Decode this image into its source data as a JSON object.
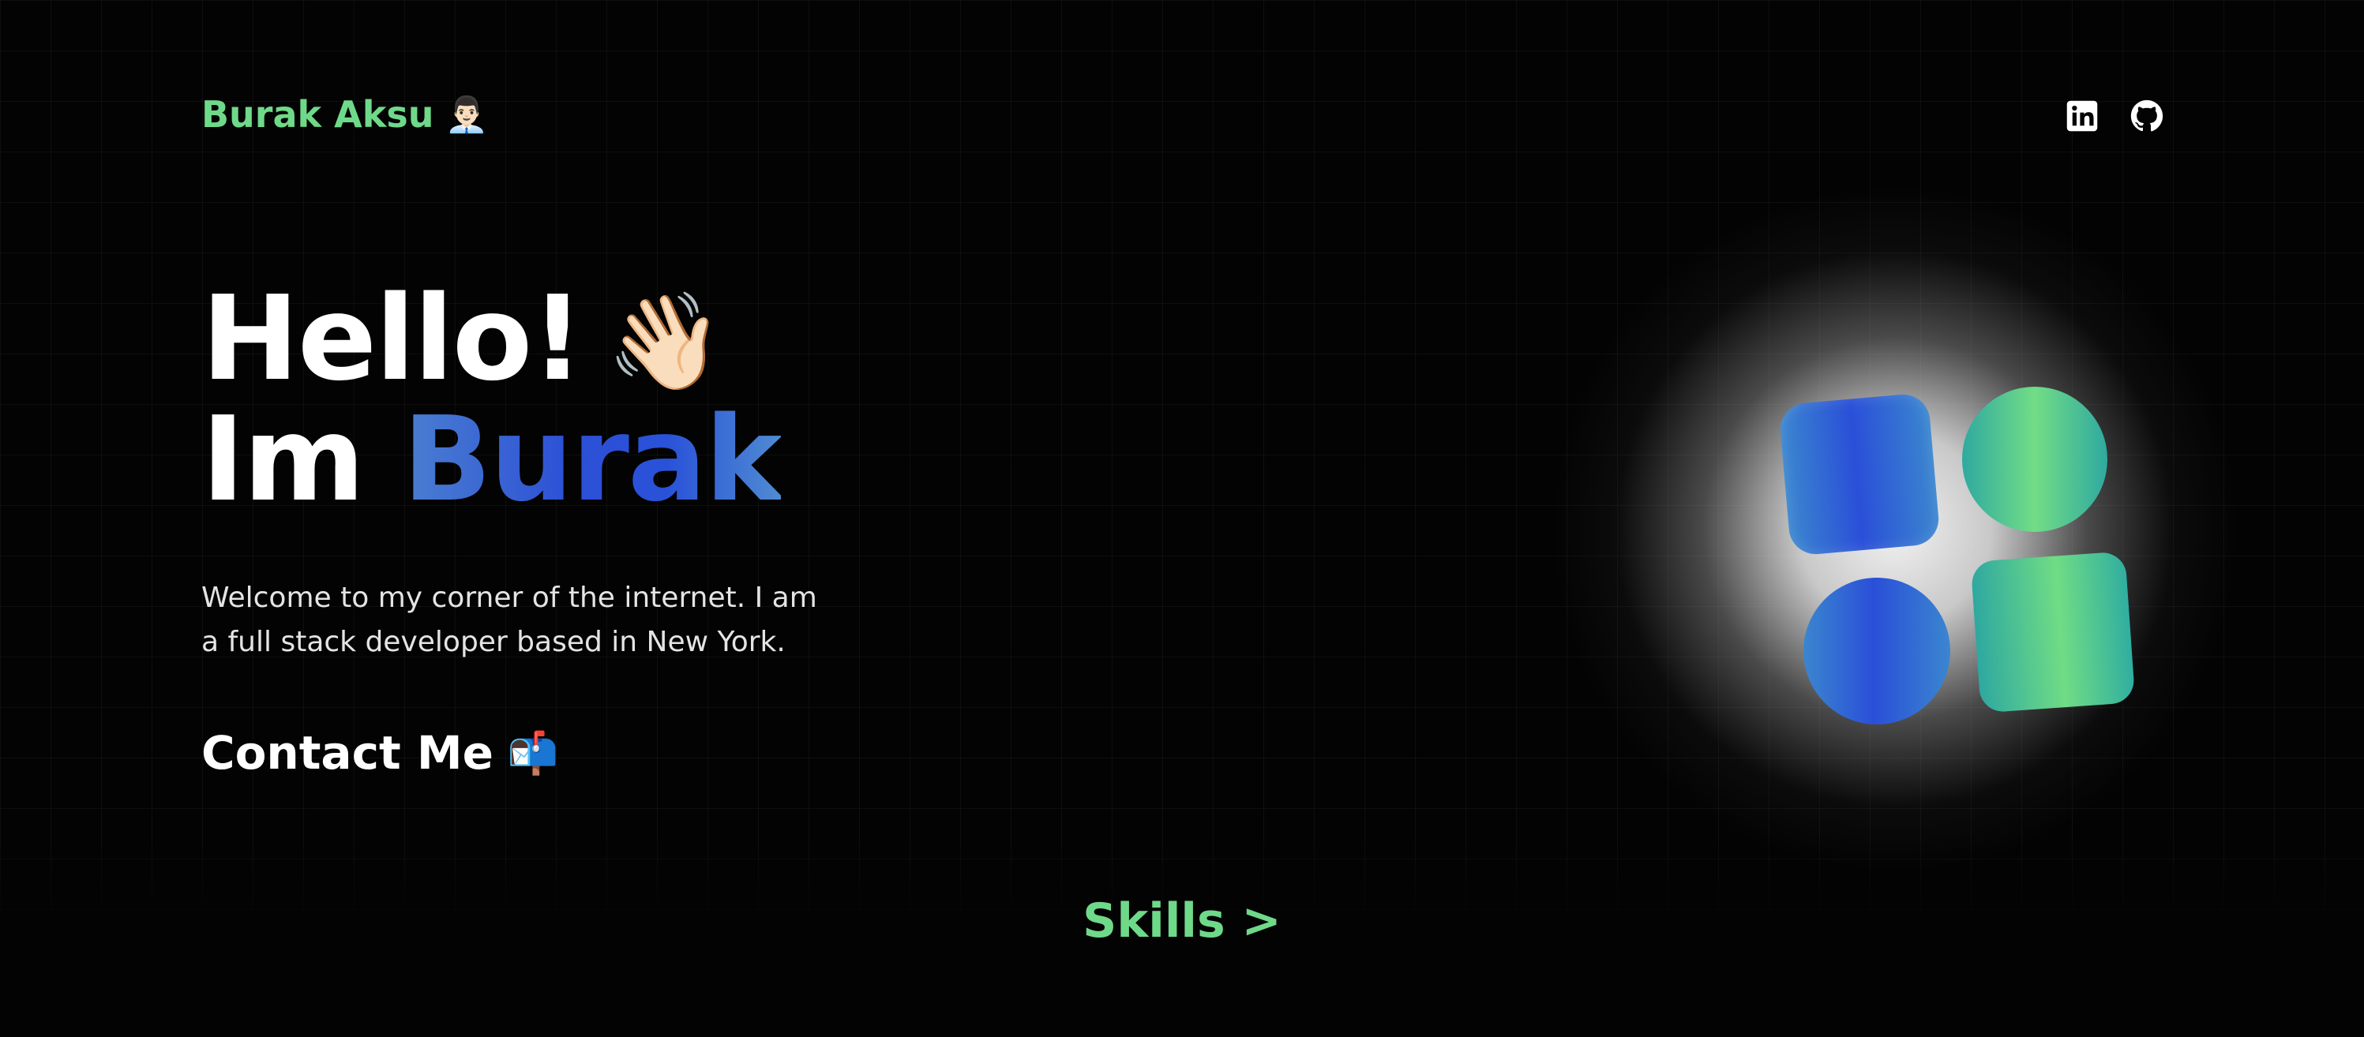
{
  "header": {
    "brand_name": "Burak Aksu",
    "brand_emoji": "👨🏻‍💼",
    "social": [
      {
        "name": "linkedin-icon"
      },
      {
        "name": "github-icon"
      }
    ]
  },
  "hero": {
    "line1": "Hello!",
    "wave_emoji": "👋🏻",
    "line2_prefix": "Im",
    "line2_name": "Burak",
    "intro": "Welcome to my corner of the internet. I am a full stack developer based in New York.",
    "contact_label": "Contact Me",
    "contact_emoji": "📬"
  },
  "footer": {
    "skills_label": "Skills >"
  },
  "colors": {
    "accent_green": "#6fd98a",
    "accent_blue": "#2a4fd8",
    "background": "#030303"
  }
}
